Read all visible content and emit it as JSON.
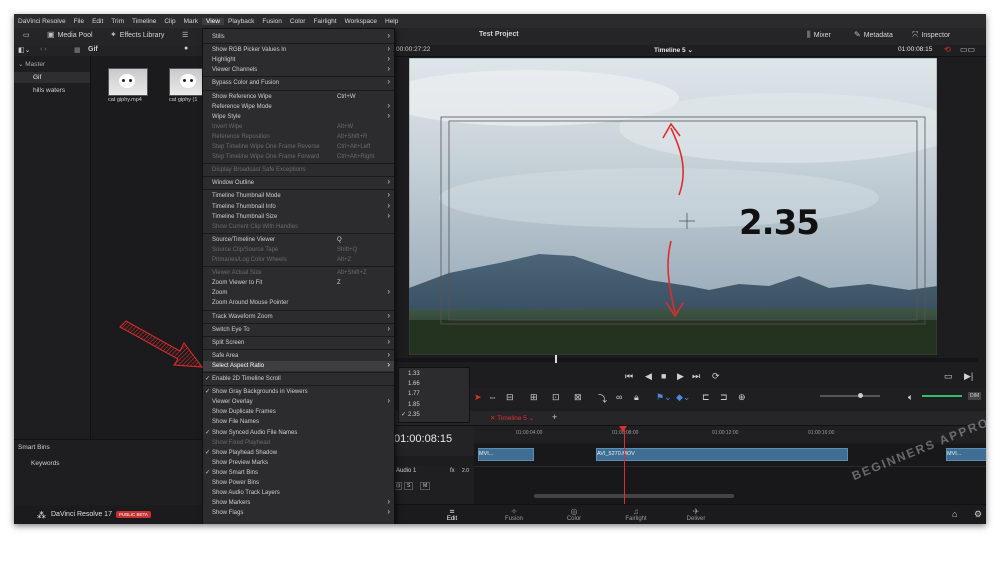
{
  "menubar": [
    "DaVinci Resolve",
    "File",
    "Edit",
    "Trim",
    "Timeline",
    "Clip",
    "Mark",
    "View",
    "Playback",
    "Fusion",
    "Color",
    "Fairlight",
    "Workspace",
    "Help"
  ],
  "toolbar": {
    "media_pool": "Media Pool",
    "effects_library": "Effects Library",
    "project_title": "Test Project",
    "mixer": "Mixer",
    "metadata": "Metadata",
    "inspector": "Inspector"
  },
  "bin_path": "Gif",
  "bins": {
    "master": "Master",
    "items": [
      "Gif",
      "hills waters"
    ]
  },
  "clips": [
    "cat giphy.mp4",
    "cat giphy (1"
  ],
  "smart_bins": {
    "title": "Smart Bins",
    "items": [
      "Keywords"
    ]
  },
  "app_footer": {
    "name": "DaVinci Resolve 17",
    "badge": "PUBLIC BETA"
  },
  "view_menu": [
    {
      "label": "Stills",
      "sub": true
    },
    {
      "sep": true
    },
    {
      "label": "Show RGB Picker Values In",
      "sub": true
    },
    {
      "label": "Highlight",
      "sub": true
    },
    {
      "label": "Viewer Channels",
      "sub": true
    },
    {
      "sep": true
    },
    {
      "label": "Bypass Color and Fusion",
      "sub": true
    },
    {
      "sep": true
    },
    {
      "label": "Show Reference Wipe",
      "shortcut": "Ctrl+W"
    },
    {
      "label": "Reference Wipe Mode",
      "sub": true
    },
    {
      "label": "Wipe Style",
      "sub": true
    },
    {
      "label": "Invert Wipe",
      "shortcut": "Alt+W",
      "disabled": true
    },
    {
      "label": "Reference Reposition",
      "shortcut": "Alt+Shift+R",
      "disabled": true
    },
    {
      "label": "Step Timeline Wipe One Frame Reverse",
      "shortcut": "Ctrl+Alt+Left",
      "disabled": true
    },
    {
      "label": "Step Timeline Wipe One Frame Forward",
      "shortcut": "Ctrl+Alt+Right",
      "disabled": true
    },
    {
      "sep": true
    },
    {
      "label": "Display Broadcast Safe Exceptions",
      "disabled": true
    },
    {
      "sep": true
    },
    {
      "label": "Window Outline",
      "sub": true
    },
    {
      "sep": true
    },
    {
      "label": "Timeline Thumbnail Mode",
      "sub": true
    },
    {
      "label": "Timeline Thumbnail Info",
      "sub": true
    },
    {
      "label": "Timeline Thumbnail Size",
      "sub": true
    },
    {
      "label": "Show Current Clip With Handles",
      "disabled": true
    },
    {
      "sep": true
    },
    {
      "label": "Source/Timeline Viewer",
      "shortcut": "Q"
    },
    {
      "label": "Source Clip/Source Tape",
      "shortcut": "Shift+Q",
      "disabled": true
    },
    {
      "label": "Primaries/Log Color Wheels",
      "shortcut": "Alt+Z",
      "disabled": true
    },
    {
      "sep": true
    },
    {
      "label": "Viewer Actual Size",
      "shortcut": "Alt+Shift+Z",
      "disabled": true
    },
    {
      "label": "Zoom Viewer to Fit",
      "shortcut": "Z"
    },
    {
      "label": "Zoom",
      "sub": true
    },
    {
      "label": "Zoom Around Mouse Pointer"
    },
    {
      "sep": true
    },
    {
      "label": "Track Waveform Zoom",
      "sub": true
    },
    {
      "sep": true
    },
    {
      "label": "Switch Eye To",
      "sub": true
    },
    {
      "sep": true
    },
    {
      "label": "Split Screen",
      "sub": true
    },
    {
      "sep": true
    },
    {
      "label": "Safe Area",
      "sub": true
    },
    {
      "label": "Select Aspect Ratio",
      "sub": true,
      "highlighted": true
    },
    {
      "sep": true
    },
    {
      "label": "Enable 2D Timeline Scroll",
      "checked": true
    },
    {
      "sep": true
    },
    {
      "label": "Show Gray Backgrounds in Viewers",
      "checked": true
    },
    {
      "label": "Viewer Overlay",
      "sub": true
    },
    {
      "label": "Show Duplicate Frames"
    },
    {
      "label": "Show File Names"
    },
    {
      "label": "Show Synced Audio File Names",
      "checked": true
    },
    {
      "label": "Show Fixed Playhead",
      "disabled": true
    },
    {
      "label": "Show Playhead Shadow",
      "checked": true
    },
    {
      "label": "Show Preview Marks"
    },
    {
      "label": "Show Smart Bins",
      "checked": true
    },
    {
      "label": "Show Power Bins"
    },
    {
      "label": "Show Audio Track Layers"
    },
    {
      "label": "Show Markers",
      "sub": true
    },
    {
      "label": "Show Flags",
      "sub": true
    }
  ],
  "aspect_ratio_menu": [
    {
      "label": "1.33",
      "checked": false
    },
    {
      "label": "1.66",
      "checked": false
    },
    {
      "label": "1.77",
      "checked": false
    },
    {
      "label": "1.85",
      "checked": false
    },
    {
      "label": "2.35",
      "checked": true
    }
  ],
  "viewer": {
    "source_timecode": "00:00:27:22",
    "timeline_name": "Timeline 5",
    "timecode": "01:00:08:15",
    "annotation": "2.35"
  },
  "timeline": {
    "tab": "Timeline 5",
    "timecode": "01:00:08:15",
    "ruler": [
      "01:00:04:00",
      "01:00:08:00",
      "01:00:12:00",
      "01:00:16:00"
    ],
    "audio_track": "Audio 1",
    "audio_fx": "fx",
    "audio_level": "2.0",
    "solo": "S",
    "mute": "M",
    "clips": [
      "MVI...",
      "AVI_5270.MOV",
      "MVI..."
    ]
  },
  "pages": [
    {
      "label": "Edit",
      "icon": "edit-page-icon",
      "active": true
    },
    {
      "label": "Fusion",
      "icon": "fusion-page-icon"
    },
    {
      "label": "Color",
      "icon": "color-page-icon"
    },
    {
      "label": "Fairlight",
      "icon": "fairlight-page-icon"
    },
    {
      "label": "Deliver",
      "icon": "deliver-page-icon"
    }
  ],
  "watermark": "BEGINNERS APPROACH",
  "colors": {
    "accent_red": "#e02c2c",
    "clip_blue": "#3e6e93"
  }
}
